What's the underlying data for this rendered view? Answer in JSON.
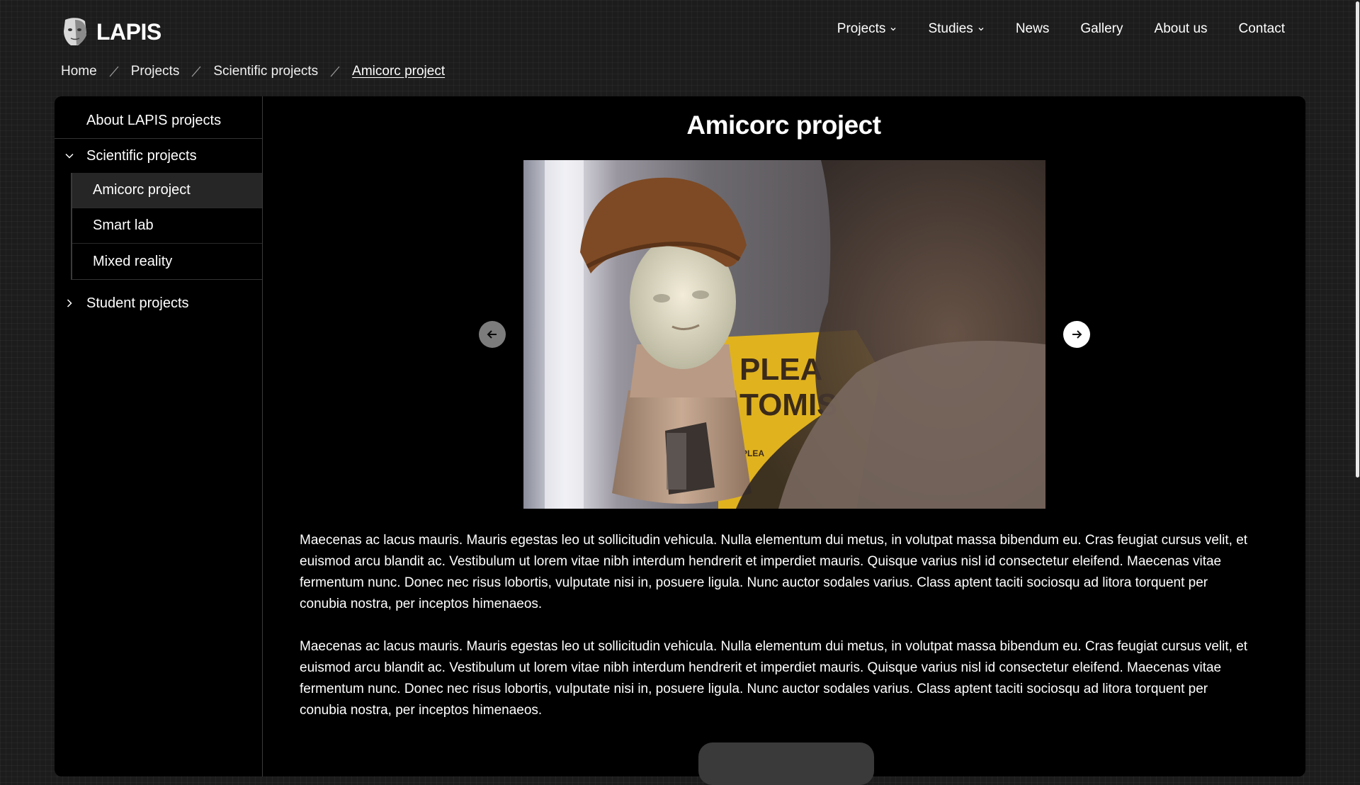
{
  "header": {
    "logo_text": "LAPIS",
    "nav": [
      {
        "label": "Projects",
        "has_dropdown": true
      },
      {
        "label": "Studies",
        "has_dropdown": true
      },
      {
        "label": "News",
        "has_dropdown": false
      },
      {
        "label": "Gallery",
        "has_dropdown": false
      },
      {
        "label": "About us",
        "has_dropdown": false
      },
      {
        "label": "Contact",
        "has_dropdown": false
      }
    ]
  },
  "breadcrumb": [
    "Home",
    "Projects",
    "Scientific projects",
    "Amicorc project"
  ],
  "sidebar": {
    "about": "About LAPIS projects",
    "scientific": {
      "label": "Scientific projects",
      "expanded": true,
      "items": [
        "Amicorc project",
        "Smart lab",
        "Mixed reality"
      ],
      "active": "Amicorc project"
    },
    "student": {
      "label": "Student projects",
      "expanded": false
    }
  },
  "main": {
    "title": "Amicorc project",
    "image": {
      "sign_text_1": "PLEA",
      "sign_text_2": "TOMIS",
      "sign_text_3": "PLEA"
    },
    "paragraphs": [
      "Maecenas ac lacus mauris. Mauris egestas leo ut sollicitudin vehicula. Nulla elementum dui metus, in volutpat massa bibendum eu. Cras feugiat cursus velit, et euismod arcu blandit ac. Vestibulum ut lorem vitae nibh interdum hendrerit et imperdiet mauris. Quisque varius nisl id consectetur eleifend. Maecenas vitae fermentum nunc. Donec nec risus lobortis, vulputate nisi in, posuere ligula. Nunc auctor sodales varius. Class aptent taciti sociosqu ad litora torquent per conubia nostra, per inceptos himenaeos.",
      "Maecenas ac lacus mauris. Mauris egestas leo ut sollicitudin vehicula. Nulla elementum dui metus, in volutpat massa bibendum eu. Cras feugiat cursus velit, et euismod arcu blandit ac. Vestibulum ut lorem vitae nibh interdum hendrerit et imperdiet mauris. Quisque varius nisl id consectetur eleifend. Maecenas vitae fermentum nunc. Donec nec risus lobortis, vulputate nisi in, posuere ligula. Nunc auctor sodales varius. Class aptent taciti sociosqu ad litora torquent per conubia nostra, per inceptos himenaeos."
    ]
  },
  "icons": {
    "logo": "mask-logo-icon",
    "dropdown": "chevron-down-icon",
    "separator": "slash-separator-icon",
    "expanded": "chevron-down-icon",
    "collapsed": "chevron-right-icon",
    "prev": "arrow-left-icon",
    "next": "arrow-right-icon"
  },
  "colors": {
    "background": "#1c1c1c",
    "panel": "#000000",
    "active_item": "#262626",
    "text": "#ffffff",
    "sign_yellow": "#e8b820"
  }
}
